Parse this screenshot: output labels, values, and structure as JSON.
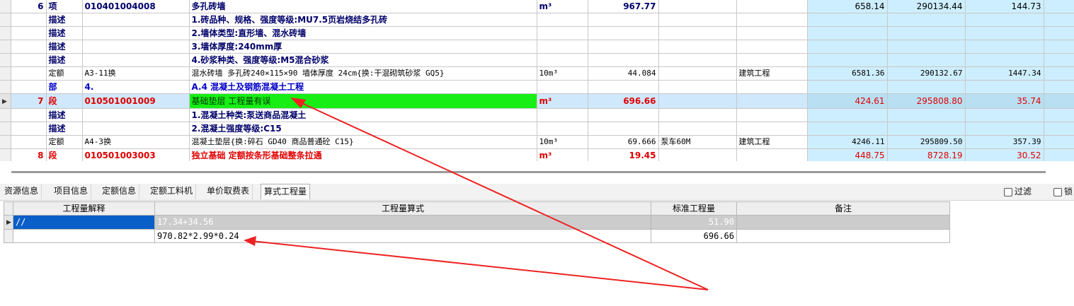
{
  "main_grid": {
    "rows": [
      {
        "seq": "6",
        "type": "项",
        "code": "010401004008",
        "name": "多孔砖墙",
        "unit": "m³",
        "qty": "967.77",
        "extra": "",
        "field": "",
        "c1": "658.14",
        "c2": "290134.44",
        "c3": "144.73"
      },
      {
        "seq": "",
        "type": "描述",
        "code": "",
        "name": "1.砖品种、规格、强度等级:MU7.5页岩烧结多孔砖",
        "unit": "",
        "qty": "",
        "extra": "",
        "field": "",
        "c1": "",
        "c2": "",
        "c3": ""
      },
      {
        "seq": "",
        "type": "描述",
        "code": "",
        "name": "2.墙体类型:直形墙、混水砖墙",
        "unit": "",
        "qty": "",
        "extra": "",
        "field": "",
        "c1": "",
        "c2": "",
        "c3": ""
      },
      {
        "seq": "",
        "type": "描述",
        "code": "",
        "name": "3.墙体厚度:240mm厚",
        "unit": "",
        "qty": "",
        "extra": "",
        "field": "",
        "c1": "",
        "c2": "",
        "c3": ""
      },
      {
        "seq": "",
        "type": "描述",
        "code": "",
        "name": "4.砂浆种类、强度等级:M5混合砂浆",
        "unit": "",
        "qty": "",
        "extra": "",
        "field": "",
        "c1": "",
        "c2": "",
        "c3": ""
      },
      {
        "seq": "",
        "type": "定额",
        "code": "A3-11换",
        "name": "混水砖墙 多孔砖240×115×90 墙体厚度 24cm{换:干混砌筑砂浆 GQ5}",
        "unit": "10m³",
        "qty": "44.084",
        "extra": "",
        "field": "建筑工程",
        "c1": "6581.36",
        "c2": "290132.67",
        "c3": "1447.34"
      },
      {
        "seq": "",
        "type": "部",
        "code": "4.",
        "name": "A.4 混凝土及钢筋混凝土工程",
        "unit": "",
        "qty": "",
        "extra": "",
        "field": "",
        "c1": "",
        "c2": "",
        "c3": ""
      },
      {
        "seq": "7",
        "type": "段",
        "code": "010501001009",
        "name": "基础垫层 工程量有误",
        "unit": "m³",
        "qty": "696.66",
        "extra": "",
        "field": "",
        "c1": "424.61",
        "c2": "295808.80",
        "c3": "35.74"
      },
      {
        "seq": "",
        "type": "描述",
        "code": "",
        "name": "1.混凝土种类:泵送商品混凝土",
        "unit": "",
        "qty": "",
        "extra": "",
        "field": "",
        "c1": "",
        "c2": "",
        "c3": ""
      },
      {
        "seq": "",
        "type": "描述",
        "code": "",
        "name": "2.混凝土强度等级:C15",
        "unit": "",
        "qty": "",
        "extra": "",
        "field": "",
        "c1": "",
        "c2": "",
        "c3": ""
      },
      {
        "seq": "",
        "type": "定额",
        "code": "A4-3换",
        "name": "混凝土垫层{换:碎石 GD40  商品普通砼  C15}",
        "unit": "10m³",
        "qty": "69.666",
        "extra": "泵车60M",
        "field": "建筑工程",
        "c1": "4246.11",
        "c2": "295809.50",
        "c3": "357.39"
      },
      {
        "seq": "8",
        "type": "段",
        "code": "010501003003",
        "name": "独立基础  定额按条形基础整条拉通",
        "unit": "m³",
        "qty": "19.45",
        "extra": "",
        "field": "",
        "c1": "448.75",
        "c2": "8728.19",
        "c3": "30.52"
      }
    ]
  },
  "tabs": [
    {
      "label": "资源信息"
    },
    {
      "label": "项目信息"
    },
    {
      "label": "定额信息"
    },
    {
      "label": "定额工料机"
    },
    {
      "label": "单价取费表"
    },
    {
      "label": "算式工程量"
    }
  ],
  "filters": {
    "filter_label": "过滤",
    "lock_label": "锁"
  },
  "formula_table": {
    "headers": {
      "explanation": "工程量解释",
      "formula": "工程量算式",
      "std_qty": "标准工程量",
      "remark": "备注"
    },
    "rows": [
      {
        "explanation": "//",
        "formula": "17.34+34.56",
        "std_qty": "51.90",
        "remark": ""
      },
      {
        "explanation": "",
        "formula": "970.82*2.99*0.24",
        "std_qty": "696.66",
        "remark": ""
      }
    ]
  },
  "colors": {
    "highlight_green": "#16ee16",
    "price_column_blue": "#cdeefe",
    "error_red": "#e00000",
    "annotation_arrow": "#ee2222"
  }
}
